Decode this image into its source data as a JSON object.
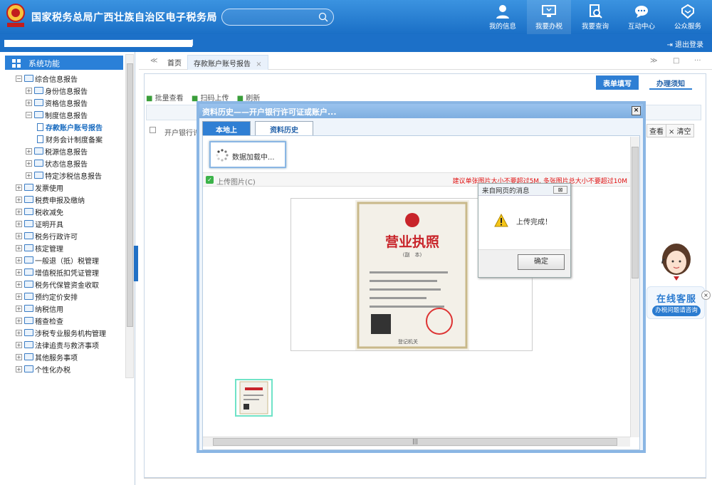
{
  "header": {
    "title": "国家税务总局广西壮族自治区电子税务局",
    "nav": [
      {
        "label": "我的信息",
        "icon": "user-icon"
      },
      {
        "label": "我要办税",
        "icon": "monitor-icon"
      },
      {
        "label": "我要查询",
        "icon": "search-doc-icon"
      },
      {
        "label": "互动中心",
        "icon": "chat-icon"
      },
      {
        "label": "公众服务",
        "icon": "service-icon"
      }
    ]
  },
  "subbar": {
    "bracket": "]",
    "logout": "退出登录"
  },
  "sidebar": {
    "title": "系统功能",
    "tree": [
      {
        "label": "综合信息报告",
        "level": 0,
        "pm": "−",
        "icon": "folder"
      },
      {
        "label": "身份信息报告",
        "level": 1,
        "pm": "+",
        "icon": "folder"
      },
      {
        "label": "资格信息报告",
        "level": 1,
        "pm": "+",
        "icon": "folder"
      },
      {
        "label": "制度信息报告",
        "level": 1,
        "pm": "−",
        "icon": "folder"
      },
      {
        "label": "存款账户账号报告",
        "level": 2,
        "pm": "",
        "icon": "doc",
        "selected": true
      },
      {
        "label": "财务会计制度备案",
        "level": 2,
        "pm": "",
        "icon": "doc"
      },
      {
        "label": "税源信息报告",
        "level": 1,
        "pm": "+",
        "icon": "folder"
      },
      {
        "label": "状态信息报告",
        "level": 1,
        "pm": "+",
        "icon": "folder"
      },
      {
        "label": "特定涉税信息报告",
        "level": 1,
        "pm": "+",
        "icon": "folder"
      },
      {
        "label": "发票使用",
        "level": 0,
        "pm": "+",
        "icon": "folder"
      },
      {
        "label": "税费申报及缴纳",
        "level": 0,
        "pm": "+",
        "icon": "folder"
      },
      {
        "label": "税收减免",
        "level": 0,
        "pm": "+",
        "icon": "folder"
      },
      {
        "label": "证明开具",
        "level": 0,
        "pm": "+",
        "icon": "folder"
      },
      {
        "label": "税务行政许可",
        "level": 0,
        "pm": "+",
        "icon": "folder"
      },
      {
        "label": "核定管理",
        "level": 0,
        "pm": "+",
        "icon": "folder"
      },
      {
        "label": "一般退（抵）税管理",
        "level": 0,
        "pm": "+",
        "icon": "folder"
      },
      {
        "label": "增值税抵扣凭证管理",
        "level": 0,
        "pm": "+",
        "icon": "folder"
      },
      {
        "label": "税务代保管资金收取",
        "level": 0,
        "pm": "+",
        "icon": "folder"
      },
      {
        "label": "预约定价安排",
        "level": 0,
        "pm": "+",
        "icon": "folder"
      },
      {
        "label": "纳税信用",
        "level": 0,
        "pm": "+",
        "icon": "folder"
      },
      {
        "label": "稽查检查",
        "level": 0,
        "pm": "+",
        "icon": "folder"
      },
      {
        "label": "涉税专业服务机构管理",
        "level": 0,
        "pm": "+",
        "icon": "folder"
      },
      {
        "label": "法律追责与救济事项",
        "level": 0,
        "pm": "+",
        "icon": "folder"
      },
      {
        "label": "其他服务事项",
        "level": 0,
        "pm": "+",
        "icon": "folder"
      },
      {
        "label": "个性化办税",
        "level": 0,
        "pm": "+",
        "icon": "folder"
      }
    ]
  },
  "tabs": {
    "back": "≪",
    "home": "首页",
    "active": "存款账户账号报告",
    "close": "×",
    "forward": "≫",
    "min": "□",
    "more": "···"
  },
  "content": {
    "tab_form": "表单填写",
    "tab_notice": "办理须知",
    "toolbar": [
      "批量查看",
      "扫码上传",
      "刷新"
    ],
    "row_label": "开户银行许",
    "right_btn_view": "查看",
    "right_btn_clear": "× 清空"
  },
  "dialog": {
    "title": "资料历史——开户银行许可证或账户...",
    "close": "×",
    "tab_local": "本地上传",
    "tab_history": "资料历史",
    "loading": "数据加载中...",
    "upload_label": "上传图片(C)",
    "hint": "建议单张图片大小不要超过5M, 多张图片总大小不要超过10M",
    "license": {
      "title": "营业执照",
      "sub": "(副　本)",
      "footer": "登记机关"
    }
  },
  "msgbox": {
    "title": "来自网页的消息",
    "close": "⊠",
    "text": "上传完成！",
    "ok": "确定"
  },
  "customer_service": {
    "title": "在线客服",
    "sub": "办税问题请咨询",
    "close": "×"
  }
}
